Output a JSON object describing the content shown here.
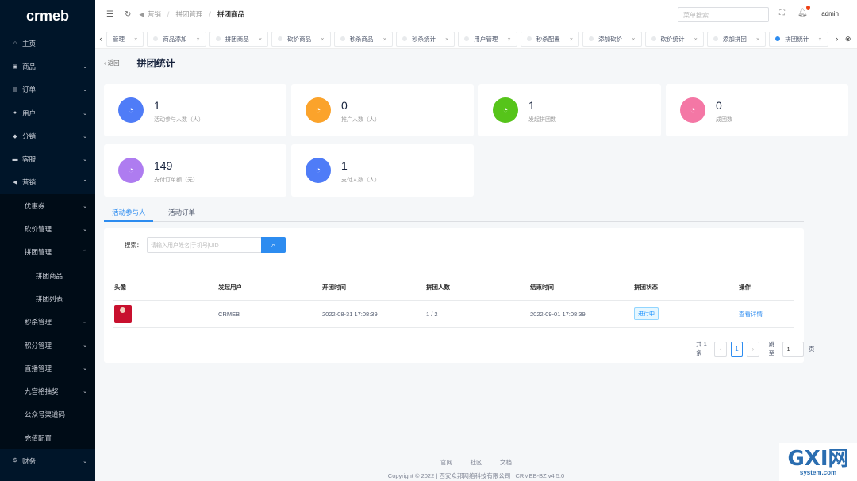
{
  "sidebar": {
    "logo": "crmeb",
    "items": [
      {
        "label": "主页",
        "icon": "home-icon",
        "glyph": "⌂"
      },
      {
        "label": "商品",
        "icon": "bag-icon",
        "glyph": "▣"
      },
      {
        "label": "订单",
        "icon": "cart-icon",
        "glyph": "▤"
      },
      {
        "label": "用户",
        "icon": "user-icon",
        "glyph": "●"
      },
      {
        "label": "分销",
        "icon": "share-icon",
        "glyph": "◆"
      },
      {
        "label": "客服",
        "icon": "chat-icon",
        "glyph": "▬"
      },
      {
        "label": "营销",
        "icon": "send-icon",
        "glyph": "◀"
      }
    ],
    "marketing_sub": [
      "优惠券",
      "砍价管理",
      "拼团管理",
      "拼团商品",
      "拼团列表",
      "秒杀管理",
      "积分管理",
      "直播管理",
      "九宫格抽奖",
      "公众号渠道码",
      "充值配置"
    ],
    "finance": {
      "label": "财务",
      "glyph": "$"
    }
  },
  "header": {
    "crumbs": [
      "营销",
      "拼团管理",
      "拼团商品"
    ],
    "search_placeholder": "菜单搜索",
    "user": "admin"
  },
  "tabs": [
    "管理",
    "商品添加",
    "拼团商品",
    "砍价商品",
    "秒杀商品",
    "秒杀统计",
    "用户管理",
    "秒杀配置",
    "添加砍价",
    "砍价统计",
    "添加拼团",
    "拼团统计"
  ],
  "page": {
    "back": "返回",
    "title": "拼团统计"
  },
  "stats": [
    {
      "value": "1",
      "label": "活动参与人数（人）",
      "color": "#4f7cf7"
    },
    {
      "value": "0",
      "label": "推广人数（人）",
      "color": "#fba32b"
    },
    {
      "value": "1",
      "label": "发起拼团数",
      "color": "#56c41a"
    },
    {
      "value": "0",
      "label": "成团数",
      "color": "#f477a5"
    },
    {
      "value": "149",
      "label": "支付订单额（元）",
      "color": "#ae7cf0"
    },
    {
      "value": "1",
      "label": "支付人数（人）",
      "color": "#4f7cf7"
    }
  ],
  "content_tabs": [
    "活动参与人",
    "活动订单"
  ],
  "search": {
    "label": "搜索：",
    "placeholder": "请输入用户姓名|手机号|UID"
  },
  "table": {
    "headers": [
      "头像",
      "发起用户",
      "开团时间",
      "拼团人数",
      "结束时间",
      "拼团状态",
      "操作"
    ],
    "rows": [
      {
        "user": "CRMEB",
        "start": "2022-08-31 17:08:39",
        "count": "1 / 2",
        "end": "2022-09-01 17:08:39",
        "status": "进行中",
        "action": "查看详情"
      }
    ]
  },
  "pager": {
    "total": "共 1 条",
    "page": "1",
    "goto": "跳至",
    "goto_value": "1",
    "unit": "页"
  },
  "footer": {
    "links": [
      "官网",
      "社区",
      "文档"
    ],
    "copyright": "Copyright © 2022 | 西安众邦网络科技有限公司 | CRMEB-BZ v4.5.0"
  },
  "watermark": {
    "main": "GXI网",
    "sub": "system.com"
  }
}
